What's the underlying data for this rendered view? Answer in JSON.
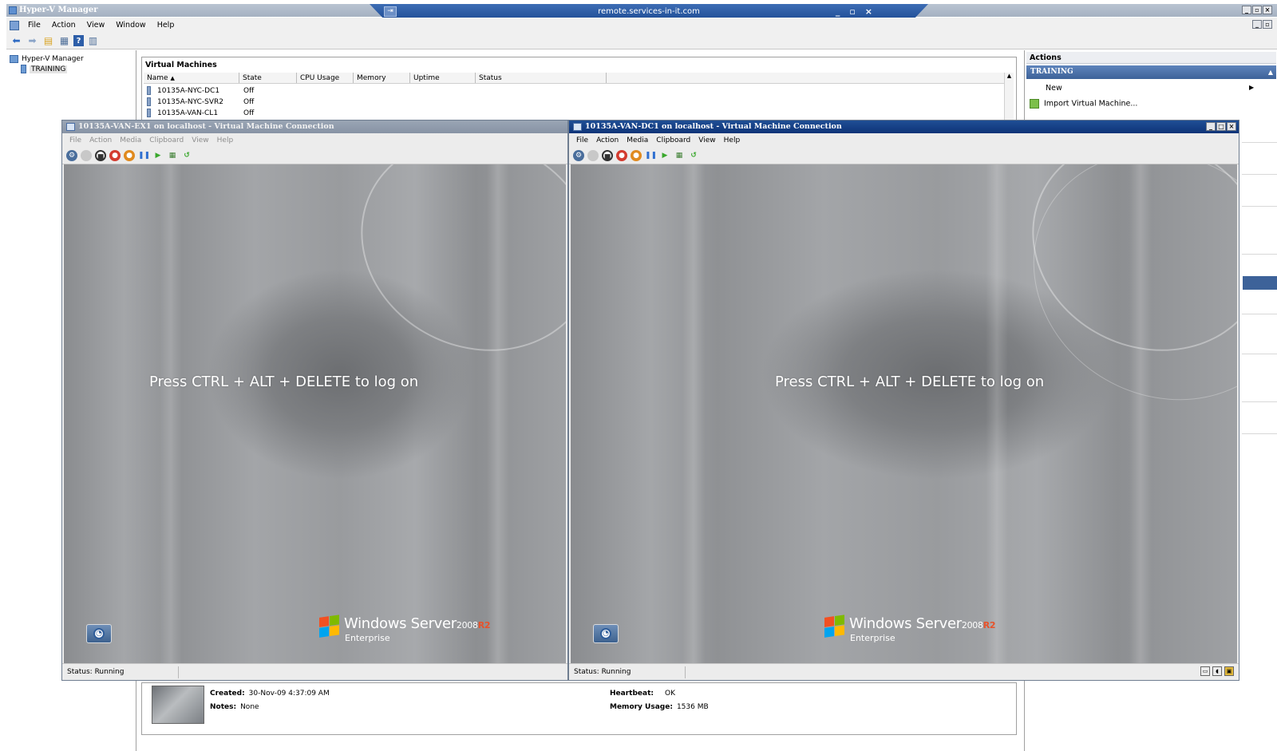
{
  "host": {
    "title": "Hyper-V Manager",
    "menu": [
      "File",
      "Action",
      "View",
      "Window",
      "Help"
    ],
    "toolbar_icons": [
      "back-icon",
      "forward-icon",
      "up-folder-icon",
      "show-hide-tree-icon",
      "help-icon",
      "properties-icon"
    ],
    "tree": {
      "root": "Hyper-V Manager",
      "server": "TRAINING"
    }
  },
  "rdp": {
    "host": "remote.services-in-it.com"
  },
  "vm_list": {
    "heading": "Virtual Machines",
    "columns": [
      "Name",
      "State",
      "CPU Usage",
      "Memory",
      "Uptime",
      "Status"
    ],
    "rows": [
      {
        "name": "10135A-NYC-DC1",
        "state": "Off"
      },
      {
        "name": "10135A-NYC-SVR2",
        "state": "Off"
      },
      {
        "name": "10135A-VAN-CL1",
        "state": "Off"
      }
    ]
  },
  "actions": {
    "heading": "Actions",
    "section": "TRAINING",
    "items": [
      "New",
      "Import Virtual Machine..."
    ]
  },
  "details": {
    "created_label": "Created:",
    "created_value": "30-Nov-09 4:37:09 AM",
    "notes_label": "Notes:",
    "notes_value": "None",
    "heartbeat_label": "Heartbeat:",
    "heartbeat_value": "OK",
    "memory_label": "Memory Usage:",
    "memory_value": "1536 MB"
  },
  "vm_windows": [
    {
      "title": "10135A-VAN-EX1 on localhost - Virtual Machine Connection",
      "menu": [
        "File",
        "Action",
        "Media",
        "Clipboard",
        "View",
        "Help"
      ],
      "screen_text": "Press CTRL + ALT + DELETE to log on",
      "brand": {
        "name": "Windows Server",
        "year": "2008",
        "release": "R2",
        "edition": "Enterprise"
      },
      "status": "Status: Running",
      "active": false
    },
    {
      "title": "10135A-VAN-DC1 on localhost - Virtual Machine Connection",
      "menu": [
        "File",
        "Action",
        "Media",
        "Clipboard",
        "View",
        "Help"
      ],
      "screen_text": "Press CTRL + ALT + DELETE to log on",
      "brand": {
        "name": "Windows Server",
        "year": "2008",
        "release": "R2",
        "edition": "Enterprise"
      },
      "status": "Status: Running",
      "active": true
    }
  ],
  "vm_toolbar_icons": [
    "ctrl-alt-del-icon",
    "start-icon",
    "turn-off-icon",
    "shutdown-icon",
    "save-icon",
    "pause-icon",
    "resume-icon",
    "snapshot-icon",
    "revert-icon"
  ],
  "colors": {
    "active_title": "#1f4e95",
    "inactive_title": "#8793a5",
    "actions_header": "#3d6299",
    "r2_accent": "#e8522a"
  }
}
